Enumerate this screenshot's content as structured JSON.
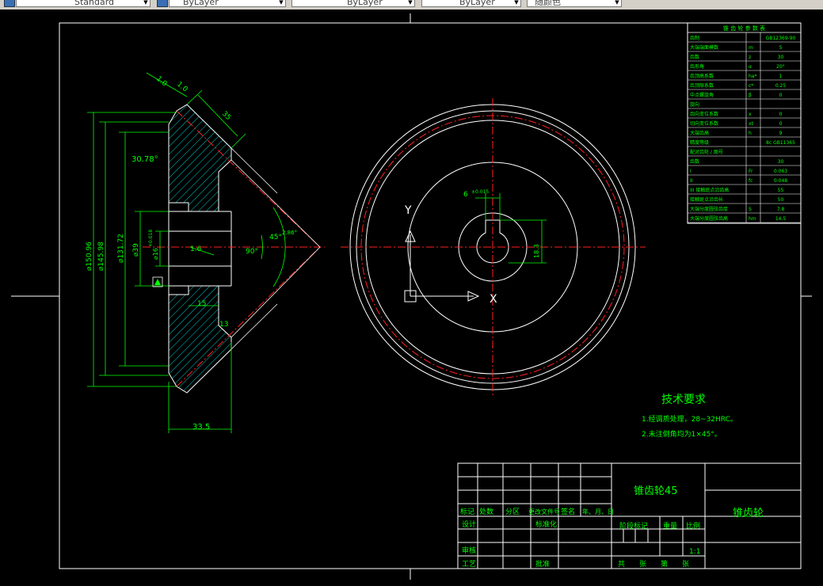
{
  "toolbar": {
    "text_style": "Standard",
    "layer": "ByLayer",
    "linetype": "ByLayer",
    "lineweight": "ByLayer",
    "color": "随颜色"
  },
  "dims": {
    "chamfer_a": "1.0",
    "chamfer_b": "1.0",
    "face_width": "35",
    "angle_top": "30.78°",
    "d_outer": "⌀150.96",
    "d_pitch": "⌀145.98",
    "d_root": "⌀131.72",
    "d_hub": "⌀39",
    "d_bore": "⌀16",
    "tol_bore": "+0.018",
    "roughness": "1.6",
    "angle_90": "90°",
    "angle_45": "45°",
    "angle_small": "2.86°",
    "hub_len": "15",
    "cone_len": "13",
    "total_width": "33.5",
    "keyway_width": "6",
    "keyway_tol": "±0.015",
    "keyway_depth": "18.3",
    "axis_y": "Y",
    "axis_x": "X"
  },
  "param_table": {
    "title": "锥 齿 轮 参 数 表",
    "rows": [
      [
        "齿制",
        "",
        "GB12369-90"
      ],
      [
        "大端端面模数",
        "m",
        "5"
      ],
      [
        "齿数",
        "z",
        "30"
      ],
      [
        "齿形角",
        "α",
        "20°"
      ],
      [
        "齿顶高系数",
        "ha*",
        "1"
      ],
      [
        "齿顶隙系数",
        "c*",
        "0.25"
      ],
      [
        "中点螺旋角",
        "β",
        "0"
      ],
      [
        "旋向",
        "",
        ""
      ],
      [
        "齿向变位系数",
        "x",
        "0"
      ],
      [
        "切向变位系数",
        "xt",
        "0"
      ],
      [
        "大端齿高",
        "h",
        "9"
      ],
      [
        "精度等级",
        "",
        "8c GB11365"
      ],
      [
        "配对齿轮 / 图号",
        "",
        ""
      ],
      [
        "齿数",
        "",
        "30"
      ],
      [
        "I",
        "Fr",
        "0.063"
      ],
      [
        "II",
        "fc",
        "0.048"
      ],
      [
        "III 接触斑点沿齿高",
        "",
        "55"
      ],
      [
        "接触斑点沿齿长",
        "",
        "50"
      ],
      [
        "大端分度圆弦齿厚",
        "S",
        "7.8"
      ],
      [
        "大端分度圆弦齿高",
        "hm",
        "14.5"
      ]
    ]
  },
  "tech": {
    "title": "技术要求",
    "line1": "1.经调质处理，28~32HRC。",
    "line2": "2.未注倒角均为1×45°。"
  },
  "title_block": {
    "part_name": "锥齿轮45",
    "drawing_name": "锥齿轮",
    "h_mark": "标记",
    "h_count": "处数",
    "h_zone": "分区",
    "h_docno": "更改文件号",
    "h_sign": "签名",
    "h_date": "年、月、日",
    "design": "设计",
    "standard": "标准化",
    "stage": "阶段标记",
    "weight": "重量",
    "scale_label": "比例",
    "scale": "1:1",
    "review": "审核",
    "craft": "工艺",
    "approve": "批准",
    "sheets": "共　　张　　第　　张"
  }
}
